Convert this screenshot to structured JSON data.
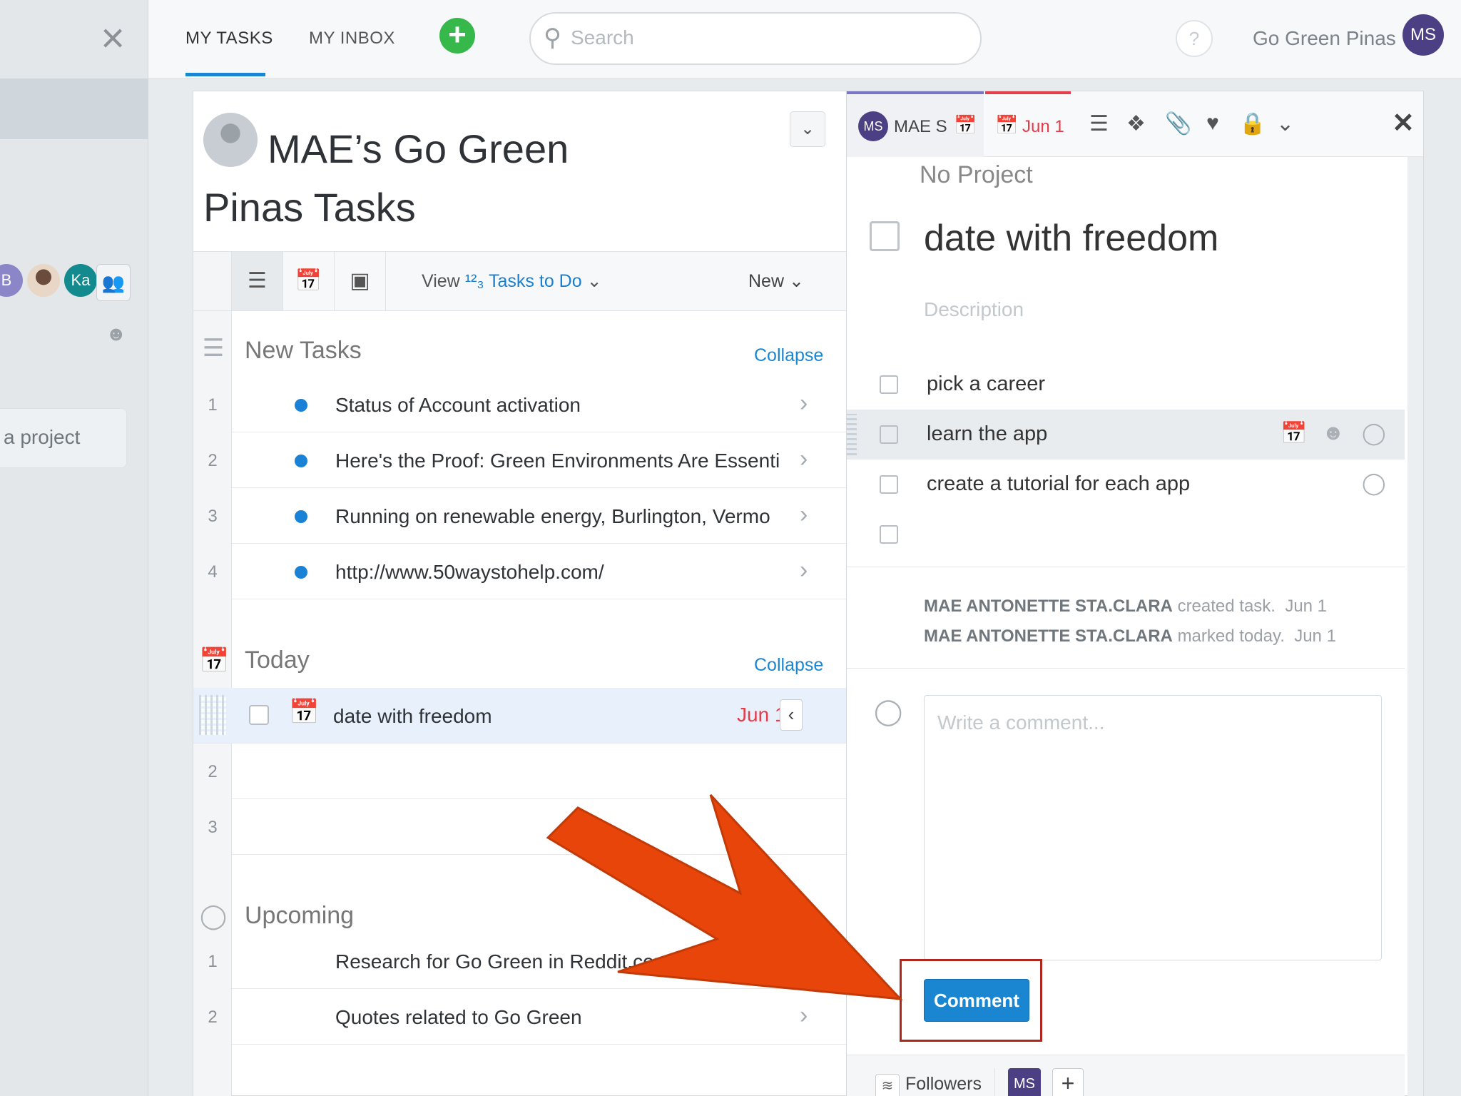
{
  "left_rail": {
    "close_label": "×",
    "avatars": [
      "B",
      "",
      "Ka"
    ],
    "project_button": "a project"
  },
  "topbar": {
    "tabs": [
      {
        "label": "MY TASKS"
      },
      {
        "label": "MY INBOX"
      }
    ],
    "add_label": "+",
    "search_placeholder": "Search",
    "help_label": "?",
    "org_name": "Go Green Pinas",
    "user_initials": "MS"
  },
  "list": {
    "title": "MAE’s Go Green Pinas Tasks",
    "view_label": "View",
    "view_filter": "Tasks to Do",
    "new_label": "New",
    "sections": {
      "new_tasks": {
        "title": "New Tasks",
        "collapse": "Collapse",
        "rows": [
          {
            "num": "1",
            "text": "Status of Account activation"
          },
          {
            "num": "2",
            "text": "Here's the Proof: Green Environments Are Essenti"
          },
          {
            "num": "3",
            "text": "Running on renewable energy, Burlington, Vermo"
          },
          {
            "num": "4",
            "text": "http://www.50waystohelp.com/"
          }
        ]
      },
      "today": {
        "title": "Today",
        "collapse": "Collapse",
        "selected": {
          "text": "date with freedom",
          "date": "Jun 1"
        },
        "empty_rows": [
          "2",
          "3"
        ]
      },
      "upcoming": {
        "title": "Upcoming",
        "rows": [
          {
            "num": "1",
            "text": "Research for Go Green in Reddit.com"
          },
          {
            "num": "2",
            "text": "Quotes related to Go Green"
          }
        ]
      }
    }
  },
  "detail": {
    "assignee_initials": "MS",
    "assignee_name": "MAE S",
    "due_date": "Jun 1",
    "project": "No Project",
    "title": "date with freedom",
    "description_placeholder": "Description",
    "subtasks": [
      {
        "text": "pick a career"
      },
      {
        "text": "learn the app"
      },
      {
        "text": "create a tutorial for each app"
      },
      {
        "text": ""
      }
    ],
    "activity": [
      {
        "actor": "MAE ANTONETTE STA.CLARA",
        "action": "created task.",
        "date": "Jun 1"
      },
      {
        "actor": "MAE ANTONETTE STA.CLARA",
        "action": "marked today.",
        "date": "Jun 1"
      }
    ],
    "comment_placeholder": "Write a comment...",
    "comment_button": "Comment",
    "followers_label": "Followers",
    "follower_initials": "MS",
    "add_follower": "+"
  },
  "colors": {
    "accent_blue": "#1a86d1",
    "add_green": "#36b84a",
    "due_red": "#e53c4a",
    "avatar_purple": "#4d3f83",
    "arrow_orange": "#e8450a",
    "highlight_border": "#b0261d"
  },
  "icons": [
    "close-icon",
    "search-icon",
    "help-icon",
    "list-view-icon",
    "calendar-view-icon",
    "image-view-icon",
    "sort-icon",
    "chevron-down-icon",
    "chevron-right-icon",
    "tag-icon",
    "attachment-icon",
    "heart-icon",
    "lock-icon",
    "comment-icon",
    "rss-icon"
  ]
}
